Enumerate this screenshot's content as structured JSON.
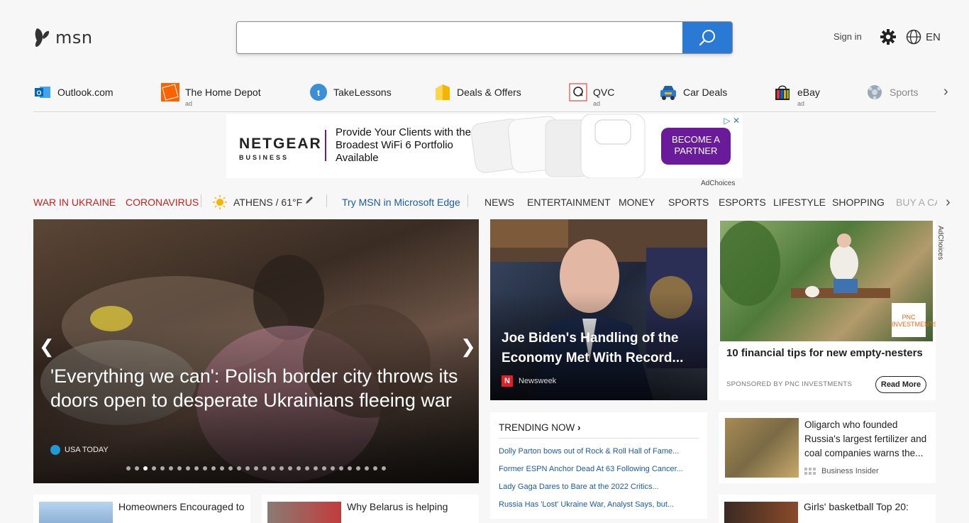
{
  "header": {
    "brand": "msn",
    "search_placeholder": "",
    "sign_in": "Sign in",
    "language": "EN"
  },
  "quick_links": [
    {
      "label": "Outlook.com",
      "icon": "outlook-icon",
      "ad": ""
    },
    {
      "label": "The Home Depot",
      "icon": "home-depot-icon",
      "ad": "ad"
    },
    {
      "label": "TakeLessons",
      "icon": "takelessons-icon",
      "ad": ""
    },
    {
      "label": "Deals & Offers",
      "icon": "deals-tag-icon",
      "ad": ""
    },
    {
      "label": "QVC",
      "icon": "qvc-icon",
      "ad": "ad"
    },
    {
      "label": "Car Deals",
      "icon": "car-icon",
      "ad": ""
    },
    {
      "label": "eBay",
      "icon": "ebay-icon",
      "ad": "ad"
    },
    {
      "label": "Sports",
      "icon": "sports-icon",
      "ad": ""
    }
  ],
  "banner": {
    "brand": "NETGEAR",
    "brand_sub": "BUSINESS",
    "copy": "Provide Your Clients with the Broadest WiFi 6 Portfolio Available",
    "cta": "BECOME A PARTNER",
    "adchoices": "AdChoices"
  },
  "nav": {
    "topic1": "WAR IN UKRAINE",
    "topic2": "CORONAVIRUS",
    "weather": "ATHENS / 61°F",
    "edge": "Try MSN in Microsoft Edge",
    "items": [
      "NEWS",
      "ENTERTAINMENT",
      "MONEY",
      "SPORTS",
      "ESPORTS",
      "LIFESTYLE",
      "SHOPPING",
      "BUY A CA"
    ]
  },
  "hero": {
    "title": "'Everything we can': Polish border city throws its doors open to desperate Ukrainians fleeing war",
    "source": "USA TODAY",
    "active_slide": 3
  },
  "card_biden": {
    "title": "Joe Biden's Handling of the Economy Met With Record...",
    "source": "Newsweek"
  },
  "card_sponsored": {
    "title": "10 financial tips for new empty-nesters",
    "sponsor": "SPONSORED BY PNC INVESTMENTS",
    "button": "Read More",
    "logo_text": "PNC INVESTMENTS",
    "adchoices": "AdChoices"
  },
  "trending": {
    "heading": "TRENDING NOW",
    "items": [
      "Dolly Parton bows out of Rock & Roll Hall of Fame...",
      "Former ESPN Anchor Dead At 63 Following Cancer...",
      "Lady Gaga Dares to Bare at the 2022 Critics...",
      "Russia Has 'Lost' Ukraine War, Analyst Says, but..."
    ]
  },
  "card_oligarch": {
    "title": "Oligarch who founded Russia's largest fertilizer and coal companies warns the...",
    "source": "Business Insider"
  },
  "bottom_cards": [
    {
      "title": "Homeowners Encouraged to"
    },
    {
      "title": "Why Belarus is helping"
    },
    {
      "title": "Girls' basketball Top 20:"
    }
  ],
  "colors": {
    "accent": "#2a7ad5",
    "topic_red": "#c42121",
    "banner_purple": "#6a1b9a"
  }
}
